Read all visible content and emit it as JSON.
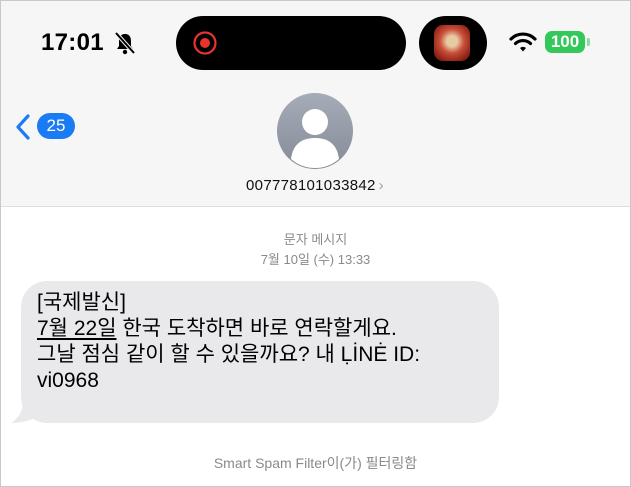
{
  "status_bar": {
    "time": "17:01",
    "silent_icon": "bell-slash-icon",
    "recording_icon": "screen-recording-icon",
    "wifi_icon": "wifi-icon",
    "battery": "100",
    "battery_color": "#34c759"
  },
  "nav": {
    "back_count": "25",
    "back_icon": "chevron-left-icon",
    "accent": "#1a7cf5",
    "contact_name": "007778101033842",
    "contact_chevron": "›"
  },
  "conversation": {
    "message_type": "문자 메시지",
    "timestamp": "7월 10일 (수) 13:33",
    "message": {
      "line1": "[국제발신]",
      "line2_link": "7월 22일",
      "line2_rest": " 한국 도착하면 바로 연락할게요.",
      "line3": "그날 점심 같이 할 수 있을까요? 내 ḶİNĖ ID:",
      "line4": "vi0968"
    },
    "footer": "Smart Spam Filter이(가) 필터링함"
  }
}
